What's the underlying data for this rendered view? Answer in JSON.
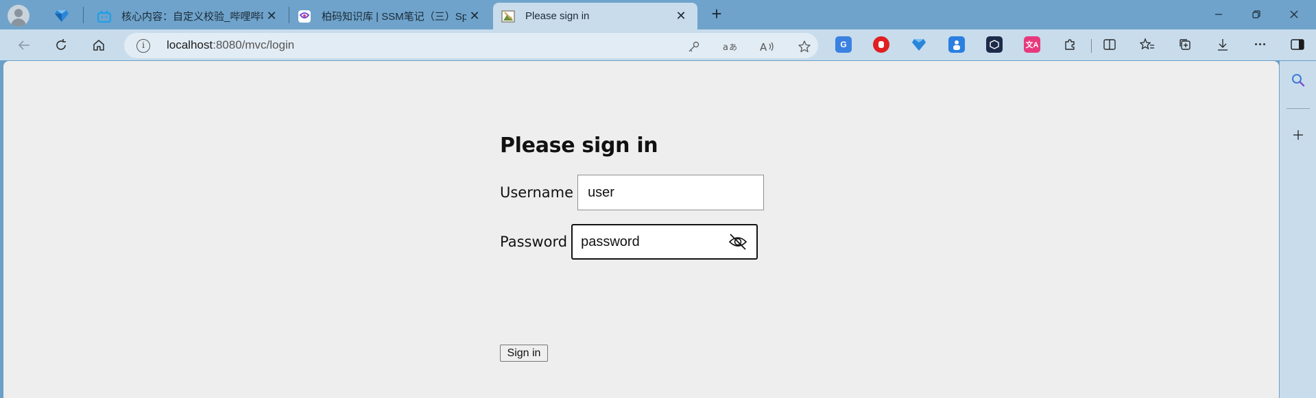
{
  "tabs": [
    {
      "title": "核心内容：自定义校验_哔哩哔哩",
      "close": "✕",
      "favicon": "bilibili-icon"
    },
    {
      "title": "柏码知识库 | SSM笔记（三）Spri",
      "close": "✕",
      "favicon": "itbaima-icon"
    },
    {
      "title": "Please sign in",
      "close": "✕",
      "favicon": "sign-in-page-icon",
      "active": true
    }
  ],
  "new_tab": "+",
  "address_bar": {
    "host": "localhost",
    "rest": ":8080/mvc/login"
  },
  "extensions": [
    "translate-icon",
    "adblock-icon",
    "diamond-icon",
    "person-icon",
    "cube-icon",
    "translate-pink-icon",
    "puzzle-icon"
  ],
  "login": {
    "heading": "Please sign in",
    "username_label": "Username",
    "username_value": "user",
    "password_label": "Password",
    "password_value": "password",
    "submit_label": "Sign in"
  },
  "colors": {
    "tabstrip_bg": "#6fa3cb",
    "toolbar_bg": "#c8dcec",
    "page_bg": "#eeeeee"
  }
}
